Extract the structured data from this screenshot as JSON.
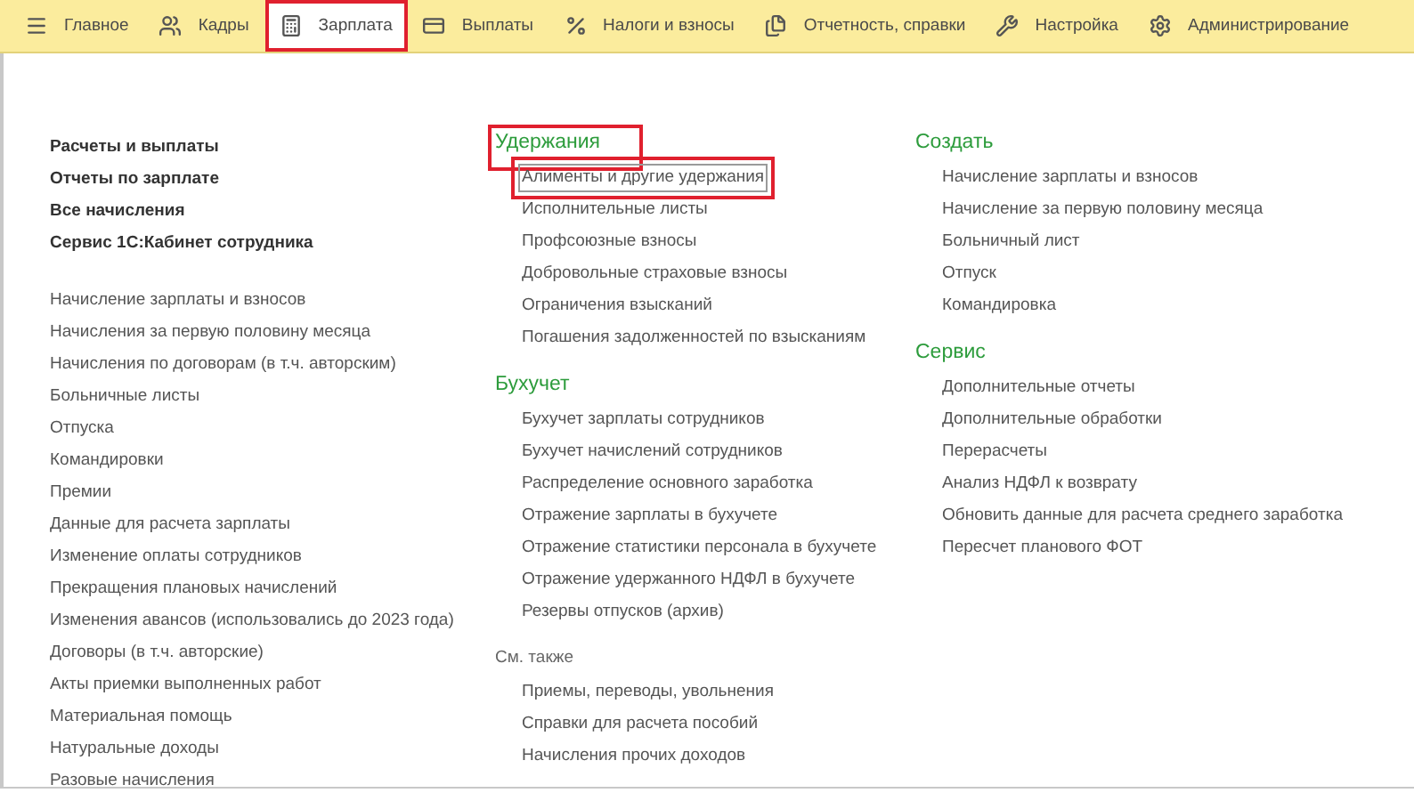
{
  "tabs": [
    {
      "label": "Главное",
      "selected": false,
      "highlighted": false
    },
    {
      "label": "Кадры",
      "selected": false,
      "highlighted": false
    },
    {
      "label": "Зарплата",
      "selected": true,
      "highlighted": true
    },
    {
      "label": "Выплаты",
      "selected": false,
      "highlighted": false
    },
    {
      "label": "Налоги и взносы",
      "selected": false,
      "highlighted": false
    },
    {
      "label": "Отчетность, справки",
      "selected": false,
      "highlighted": false
    },
    {
      "label": "Настройка",
      "selected": false,
      "highlighted": false
    },
    {
      "label": "Администрирование",
      "selected": false,
      "highlighted": false
    }
  ],
  "left_panel": {
    "bold_links": [
      "Расчеты и выплаты",
      "Отчеты по зарплате",
      "Все начисления",
      "Сервис 1С:Кабинет сотрудника"
    ],
    "links": [
      "Начисление зарплаты и взносов",
      "Начисления за первую половину месяца",
      "Начисления по договорам (в т.ч. авторским)",
      "Больничные листы",
      "Отпуска",
      "Командировки",
      "Премии",
      "Данные для расчета зарплаты",
      "Изменение оплаты сотрудников",
      "Прекращения плановых начислений",
      "Изменения авансов (использовались до 2023 года)",
      "Договоры (в т.ч. авторские)",
      "Акты приемки выполненных работ",
      "Материальная помощь",
      "Натуральные доходы",
      "Разовые начисления"
    ]
  },
  "columns": [
    {
      "sections": [
        {
          "title": "Удержания",
          "kind": "section",
          "highlighted": true,
          "items": [
            {
              "label": "Алименты и другие удержания",
              "selected": true
            },
            {
              "label": "Исполнительные листы",
              "selected": false
            },
            {
              "label": "Профсоюзные взносы",
              "selected": false
            },
            {
              "label": "Добровольные страховые взносы",
              "selected": false
            },
            {
              "label": "Ограничения взысканий",
              "selected": false
            },
            {
              "label": "Погашения задолженностей по взысканиям",
              "selected": false
            }
          ]
        },
        {
          "title": "Бухучет",
          "kind": "section",
          "highlighted": false,
          "items": [
            {
              "label": "Бухучет зарплаты сотрудников",
              "selected": false
            },
            {
              "label": "Бухучет начислений сотрудников",
              "selected": false
            },
            {
              "label": "Распределение основного заработка",
              "selected": false
            },
            {
              "label": "Отражение зарплаты в бухучете",
              "selected": false
            },
            {
              "label": "Отражение статистики персонала в бухучете",
              "selected": false
            },
            {
              "label": "Отражение удержанного НДФЛ в бухучете",
              "selected": false
            },
            {
              "label": "Резервы отпусков (архив)",
              "selected": false
            }
          ]
        },
        {
          "title": "См. также",
          "kind": "see_also",
          "highlighted": false,
          "items": [
            {
              "label": "Приемы, переводы, увольнения",
              "selected": false
            },
            {
              "label": "Справки для расчета пособий",
              "selected": false
            },
            {
              "label": "Начисления прочих доходов",
              "selected": false
            }
          ]
        }
      ]
    },
    {
      "sections": [
        {
          "title": "Создать",
          "kind": "section",
          "highlighted": false,
          "items": [
            {
              "label": "Начисление зарплаты и взносов",
              "selected": false
            },
            {
              "label": "Начисление за первую половину месяца",
              "selected": false
            },
            {
              "label": "Больничный лист",
              "selected": false
            },
            {
              "label": "Отпуск",
              "selected": false
            },
            {
              "label": "Командировка",
              "selected": false
            }
          ]
        },
        {
          "title": "Сервис",
          "kind": "section",
          "highlighted": false,
          "items": [
            {
              "label": "Дополнительные отчеты",
              "selected": false
            },
            {
              "label": "Дополнительные обработки",
              "selected": false
            },
            {
              "label": "Перерасчеты",
              "selected": false
            },
            {
              "label": "Анализ НДФЛ к возврату",
              "selected": false
            },
            {
              "label": "Обновить данные для расчета среднего заработка",
              "selected": false
            },
            {
              "label": "Пересчет планового ФОТ",
              "selected": false
            }
          ]
        }
      ]
    }
  ]
}
